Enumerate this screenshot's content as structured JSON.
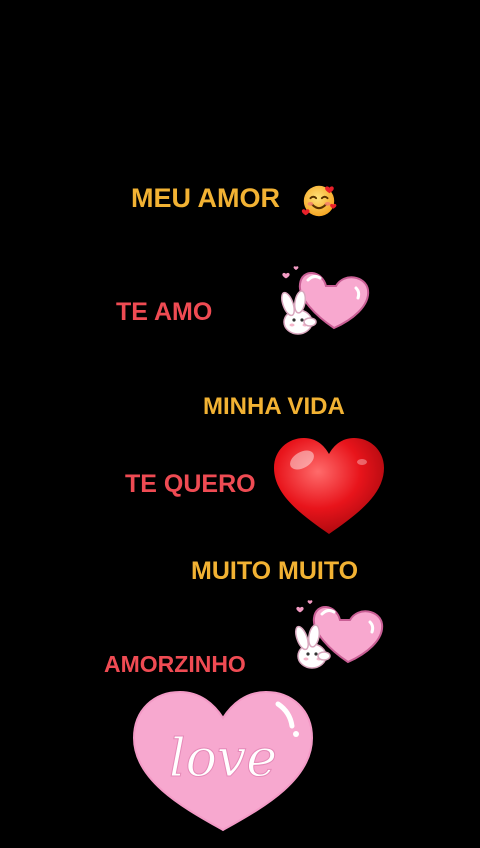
{
  "lines": [
    {
      "text": "MEU AMOR",
      "color": "#F2B233"
    },
    {
      "text": "TE AMO",
      "color": "#EF4B53"
    },
    {
      "text": "MINHA VIDA",
      "color": "#F2B233"
    },
    {
      "text": "TE QUERO",
      "color": "#EF4B53"
    },
    {
      "text": "MUITO MUITO",
      "color": "#F2B233"
    },
    {
      "text": "AMORZINHO",
      "color": "#EF4B53"
    }
  ],
  "stickers": {
    "emoji": "smiling-face-with-hearts-icon",
    "bunny_heart_1": "bunny-hugging-pink-heart-icon",
    "red_heart": "red-heart-icon",
    "bunny_heart_2": "bunny-hugging-pink-heart-icon",
    "love_heart": "pink-love-heart-icon",
    "love_heart_text": "love"
  },
  "colors": {
    "background": "#000000",
    "yellow": "#F2B233",
    "red": "#EF4B53",
    "pink": "#F7A8CF"
  }
}
